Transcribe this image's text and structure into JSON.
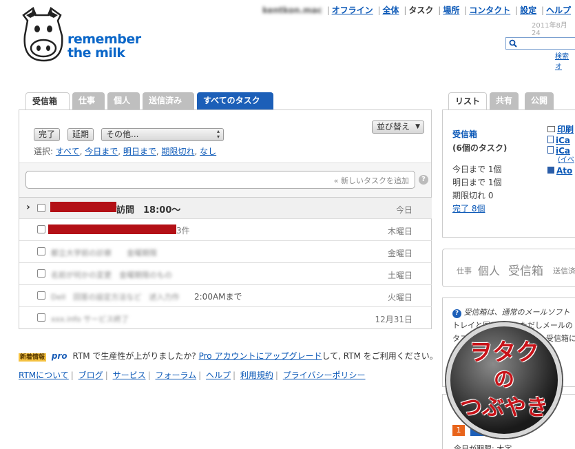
{
  "header": {
    "user": "kentkon.mac",
    "nav": [
      "オフライン",
      "全体",
      "タスク",
      "場所",
      "コンタクト",
      "設定",
      "ヘルプ"
    ],
    "date": "2011年8月24",
    "search_link": "検索オ"
  },
  "logo": {
    "line1": "remember",
    "line2": "the milk",
    "tm": "™"
  },
  "tabs": [
    "受信箱",
    "仕事",
    "個人",
    "送信済み",
    "すべてのタスク"
  ],
  "toolbar": {
    "done": "完了",
    "postpone": "延期",
    "more": "その他...",
    "sort": "並び替え",
    "select_label": "選択:",
    "select_links": [
      "すべて",
      "今日まで",
      "明日まで",
      "期限切れ",
      "なし"
    ]
  },
  "add_task": {
    "placeholder": "« 新しいタスクを追加",
    "help": "?"
  },
  "tasks": [
    {
      "text": "訪問　18:00〜",
      "day": "今日",
      "bold": true
    },
    {
      "text": "3件",
      "day": "木曜日"
    },
    {
      "text": "都立大学前の診察　　金曜期限",
      "day": "金曜日"
    },
    {
      "text": "名前が何かの変更　金曜期限のもの",
      "day": "土曜日"
    },
    {
      "text": "Dell　回答の設定方法など　述入力作",
      "extra": "2:00AMまで",
      "day": "火曜日"
    },
    {
      "text": "xxx.info サービス終了",
      "day": "12月31日"
    }
  ],
  "promo": {
    "badge": "新着情報",
    "pro": "pro",
    "text1": "RTM で生産性が上がりましたか?",
    "link": "Pro アカウントにアップグレード",
    "text2": "して, RTM をご利用ください。"
  },
  "footer": [
    "RTMについて",
    "ブログ",
    "サービス",
    "フォーラム",
    "ヘルプ",
    "利用規約",
    "プライバシーポリシー"
  ],
  "right": {
    "tabs": [
      "リスト",
      "共有",
      "公開"
    ],
    "list_title": "受信箱",
    "list_count": "(6個のタスク)",
    "stats": [
      "今日まで 1個",
      "明日まで 1個",
      "期限切れ 0"
    ],
    "done_link": "完了 8個",
    "links": [
      "印刷",
      "iCa",
      "iCa",
      "(イベ",
      "Ato"
    ],
    "cloud": [
      "仕事",
      "個人",
      "受信箱",
      "送信済"
    ],
    "info_text1": "受信箱は、通常のメールソフト",
    "info_text2": "トレイと同じです。ただしメールの",
    "info_text3": "タス",
    "info_text4": "受信箱につい",
    "bottom_badge": "1",
    "bottom_text": "今日が期限: 大字"
  },
  "stamp": {
    "line1": "ヲタク",
    "line2": "の",
    "line3": "つぶやき"
  }
}
